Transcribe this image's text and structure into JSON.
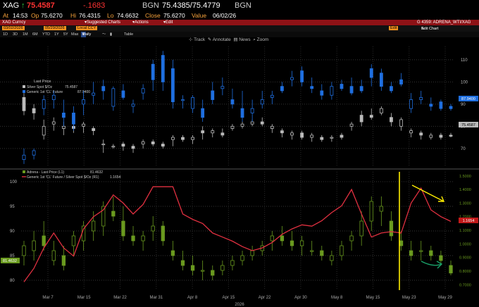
{
  "header": {
    "ticker": "XAG",
    "last_arrow": "↑",
    "last": "75.4587",
    "change": "-.1683",
    "bgn_label": "BGN",
    "bid_ask": "75.4385/75.4779",
    "bgn_label2": "BGN",
    "at_label": "At",
    "time": "14:53",
    "op_label": "Op",
    "open": "75.6270",
    "hi_label": "Hi",
    "high": "76.4315",
    "lo_label": "Lo",
    "low": "74.6632",
    "close_label": "Close",
    "close": "75.6270",
    "value_label": "Value",
    "value_date": "06/02/26"
  },
  "toolbar": {
    "security": "XAG Curncy",
    "suggested_charts": "Suggested Charts",
    "actions": "Actions",
    "edit": "Edit",
    "chart_id": "G 4359: ADRENA_WTI/XAG",
    "date_from": "03/02/2026",
    "date_to": "05/29/2026",
    "currency": "Local CCY",
    "orange_button": "Edit",
    "edit_chart": "Edit Chart",
    "ranges": [
      "1D",
      "3D",
      "1M",
      "6M",
      "YTD",
      "1Y",
      "5Y",
      "Max"
    ],
    "freq": "Daily",
    "table": "Table",
    "tools": [
      {
        "icon": "track-icon",
        "label": "Track"
      },
      {
        "icon": "annotate-icon",
        "label": "Annotate"
      },
      {
        "icon": "news-icon",
        "label": "News"
      },
      {
        "icon": "zoom-icon",
        "label": "Zoom"
      }
    ]
  },
  "legends": {
    "top_title": "Last Price",
    "top": [
      {
        "name": "Silver Spot $/Oz",
        "value": "75.4587",
        "color": "#bbbbbb"
      },
      {
        "name": "Generic 1st 'CL' Future",
        "value": "87.9400",
        "color": "#1f6fe0"
      }
    ],
    "bottom": [
      {
        "name": "Adrena - Last Price (L1)",
        "value": "81.4632",
        "color": "#6a9a1f"
      },
      {
        "name": "Generic 1st 'CL' Future / Silver Spot $/Oz (R1)",
        "value": "1.1654",
        "color": "#e03040"
      }
    ]
  },
  "value_tags": {
    "top_cl": "87.9400",
    "top_xag": "75.4587",
    "bottom_ratio": "1.1654",
    "bottom_adrena": "81.4632"
  },
  "colors": {
    "cl": "#1f6fe0",
    "xag": "#bbbbbb",
    "adrena": "#6a9a1f",
    "ratio": "#e03040",
    "annotation_line": "#ffee00",
    "annotation_arrow_down": "#ffee00",
    "annotation_arrow_up": "#1aa36a",
    "header_bar": "#8e1216"
  },
  "chart_data": [
    {
      "type": "candlestick",
      "name": "price panel",
      "series": [
        {
          "name": "Silver Spot $/Oz",
          "color": "#bbbbbb",
          "ohlc": [
            [
              93,
              95,
              85,
              87
            ],
            [
              88,
              90,
              83,
              86
            ],
            [
              76,
              83,
              74,
              80
            ],
            [
              81,
              84,
              78,
              82
            ],
            [
              79,
              82,
              76,
              80
            ],
            [
              80,
              81,
              77,
              79
            ],
            [
              80,
              82,
              77,
              81
            ],
            [
              79,
              80,
              76,
              78
            ],
            [
              72,
              74,
              68,
              72
            ],
            [
              71,
              72,
              70,
              71
            ],
            [
              72,
              73,
              69,
              71
            ],
            [
              71,
              72,
              68,
              70
            ],
            [
              72,
              74,
              70,
              73
            ],
            [
              73,
              74,
              71,
              72
            ],
            [
              72,
              73,
              70,
              71
            ],
            [
              74,
              76,
              71,
              75
            ],
            [
              75,
              76,
              73,
              74
            ],
            [
              74,
              76,
              72,
              75
            ],
            [
              78,
              80,
              74,
              77
            ],
            [
              77,
              79,
              75,
              78
            ],
            [
              77,
              79,
              75,
              76
            ],
            [
              79,
              81,
              78,
              80
            ],
            [
              80,
              82,
              79,
              81
            ],
            [
              81,
              83,
              80,
              82
            ],
            [
              82,
              84,
              80,
              81
            ],
            [
              79,
              81,
              77,
              80
            ],
            [
              78,
              79,
              75,
              77
            ],
            [
              76,
              78,
              74,
              77
            ],
            [
              77,
              78,
              74,
              75
            ],
            [
              75,
              77,
              73,
              76
            ],
            [
              75,
              76,
              73,
              74
            ],
            [
              75,
              76,
              73,
              75
            ],
            [
              76,
              77,
              74,
              75
            ],
            [
              80,
              82,
              78,
              81
            ],
            [
              85,
              87,
              80,
              82
            ],
            [
              85,
              88,
              83,
              84
            ],
            [
              86,
              89,
              85,
              88
            ],
            [
              84,
              86,
              80,
              82
            ],
            [
              80,
              84,
              78,
              83
            ],
            [
              77,
              79,
              75,
              78
            ],
            [
              77,
              78,
              74,
              76
            ],
            [
              75,
              77,
              74,
              76
            ],
            [
              76,
              77,
              74,
              75
            ],
            [
              76,
              77,
              75,
              75.5
            ]
          ]
        },
        {
          "name": "Generic 1st 'CL' Future",
          "color": "#1f6fe0",
          "ohlc": [
            [
              65,
              70,
              63,
              67
            ],
            [
              67,
              70,
              65,
              69
            ],
            [
              88,
              94,
              85,
              92
            ],
            [
              92,
              96,
              88,
              94
            ],
            [
              86,
              92,
              80,
              84
            ],
            [
              86,
              89,
              78,
              81
            ],
            [
              90,
              96,
              85,
              92
            ],
            [
              94,
              100,
              90,
              95
            ],
            [
              98,
              101,
              92,
              96
            ],
            [
              89,
              98,
              87,
              97
            ],
            [
              96,
              99,
              92,
              93
            ],
            [
              89,
              92,
              86,
              90
            ],
            [
              95,
              99,
              92,
              97
            ],
            [
              108,
              110,
              96,
              101
            ],
            [
              112,
              114,
              96,
              100
            ],
            [
              106,
              110,
              88,
              91
            ],
            [
              92,
              94,
              88,
              92
            ],
            [
              88,
              94,
              86,
              93
            ],
            [
              88,
              92,
              82,
              84
            ],
            [
              96,
              100,
              90,
              92
            ],
            [
              97,
              102,
              94,
              98
            ],
            [
              92,
              97,
              88,
              90
            ],
            [
              88,
              96,
              82,
              84
            ],
            [
              86,
              92,
              82,
              88
            ],
            [
              90,
              96,
              88,
              92
            ],
            [
              93,
              96,
              90,
              94
            ],
            [
              98,
              100,
              95,
              96
            ],
            [
              101,
              105,
              98,
              102
            ],
            [
              105,
              107,
              98,
              100
            ],
            [
              98,
              102,
              95,
              97
            ],
            [
              96,
              99,
              92,
              94
            ],
            [
              94,
              100,
              92,
              98
            ],
            [
              99,
              101,
              96,
              97
            ],
            [
              98,
              102,
              94,
              95
            ],
            [
              98,
              101,
              95,
              96
            ],
            [
              106,
              108,
              98,
              102
            ],
            [
              104,
              106,
              96,
              98
            ],
            [
              98,
              100,
              95,
              96
            ],
            [
              101,
              104,
              98,
              99
            ],
            [
              88,
              95,
              86,
              92
            ],
            [
              92,
              96,
              90,
              93
            ],
            [
              90,
              93,
              87,
              89
            ],
            [
              91,
              92,
              87,
              88
            ],
            [
              89,
              90,
              87,
              87.94
            ]
          ]
        }
      ],
      "y_ticks": [
        "70",
        "80",
        "90",
        "100",
        "110"
      ],
      "ylim": [
        62,
        116
      ]
    },
    {
      "type": "bar_line",
      "name": "adrena vs ratio panel",
      "x_ticks": [
        "Mar 7",
        "Mar 15",
        "Mar 22",
        "Mar 31",
        "Apr 8",
        "Apr 15",
        "Apr 22",
        "Apr 30",
        "May 8",
        "May 15",
        "May 23",
        "May 29"
      ],
      "x_year": "2026",
      "left_ticks": [
        "80",
        "85",
        "90",
        "95",
        "100"
      ],
      "left_lim": [
        78,
        102
      ],
      "right_ticks": [
        "0.7000",
        "0.8000",
        "0.9000",
        "1.0000",
        "1.1000",
        "1.2000",
        "1.3000",
        "1.4000",
        "1.5000"
      ],
      "right_lim": [
        0.66,
        1.53
      ],
      "series": [
        {
          "name": "Adrena - Last Price (L1)",
          "color": "#6a9a1f",
          "ohlc": [
            [
              85,
              88,
              83,
              87
            ],
            [
              86,
              90,
              84,
              88
            ],
            [
              89,
              92,
              86,
              87
            ],
            [
              84,
              88,
              83,
              86
            ],
            [
              85,
              87,
              82,
              83
            ],
            [
              87,
              90,
              85,
              89
            ],
            [
              88,
              92,
              86,
              91
            ],
            [
              90,
              94,
              88,
              92
            ],
            [
              91,
              96,
              89,
              95
            ],
            [
              94,
              97,
              92,
              93
            ],
            [
              92,
              95,
              88,
              89
            ],
            [
              89,
              91,
              87,
              88
            ],
            [
              88,
              90,
              86,
              89
            ],
            [
              90,
              93,
              88,
              91
            ],
            [
              91,
              92,
              87,
              88
            ],
            [
              86,
              88,
              84,
              85
            ],
            [
              84,
              86,
              82,
              83
            ],
            [
              83,
              85,
              81,
              82
            ],
            [
              82,
              84,
              80,
              82
            ],
            [
              82,
              83,
              80,
              81
            ],
            [
              82,
              84,
              81,
              83
            ],
            [
              83,
              85,
              82,
              84
            ],
            [
              84,
              86,
              83,
              85
            ],
            [
              85,
              87,
              84,
              86
            ],
            [
              86,
              88,
              85,
              87
            ],
            [
              88,
              90,
              86,
              89
            ],
            [
              89,
              91,
              87,
              88
            ],
            [
              88,
              90,
              86,
              87
            ],
            [
              87,
              89,
              85,
              88
            ],
            [
              86,
              88,
              85,
              86
            ],
            [
              86,
              87,
              84,
              85
            ],
            [
              84,
              86,
              83,
              85
            ],
            [
              85,
              88,
              84,
              87
            ],
            [
              88,
              90,
              86,
              89
            ],
            [
              89,
              94,
              87,
              92
            ],
            [
              92,
              97,
              90,
              96
            ],
            [
              94,
              97,
              91,
              95
            ],
            [
              92,
              94,
              88,
              89
            ],
            [
              88,
              90,
              86,
              87
            ],
            [
              86,
              88,
              84,
              85
            ],
            [
              86,
              88,
              84,
              86
            ],
            [
              86,
              87,
              84,
              85
            ],
            [
              85,
              86,
              83,
              84
            ],
            [
              83,
              84,
              81,
              81.46
            ]
          ]
        },
        {
          "name": "Generic 1st 'CL' Future / Silver Spot $/Oz (R1)",
          "color": "#e03040",
          "values": [
            0.72,
            0.82,
            0.97,
            1.08,
            0.97,
            0.91,
            1.11,
            1.2,
            1.25,
            1.36,
            1.3,
            1.22,
            1.29,
            1.42,
            1.42,
            1.42,
            1.22,
            1.18,
            1.15,
            1.08,
            1.05,
            1.02,
            0.98,
            0.95,
            0.97,
            1.01,
            1.07,
            1.11,
            1.14,
            1.13,
            1.17,
            1.23,
            1.28,
            1.4,
            1.22,
            1.05,
            1.08,
            1.09,
            1.08,
            1.3,
            1.41,
            1.25,
            1.2,
            1.1654
          ]
        }
      ]
    }
  ]
}
